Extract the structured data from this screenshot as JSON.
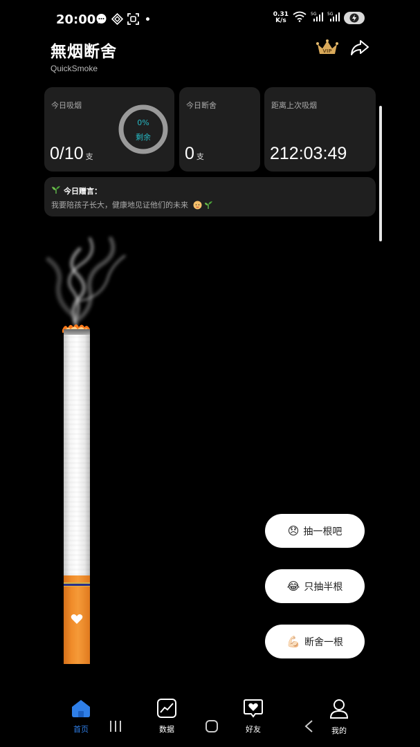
{
  "status_bar": {
    "time": "20:00",
    "net_speed_value": "0.31",
    "net_speed_unit": "K/s"
  },
  "header": {
    "title": "無烟断舍",
    "subtitle": "QuickSmoke",
    "vip_label": "VIP"
  },
  "stats": {
    "today_smoked": {
      "label": "今日吸烟",
      "value": "0/10",
      "unit": "支",
      "ring_percent_text": "0%",
      "ring_label": "剩余",
      "remaining_fraction": 0
    },
    "today_quit": {
      "label": "今日断舍",
      "value": "0",
      "unit": "支"
    },
    "since_last": {
      "label": "距离上次吸烟",
      "value": "212:03:49"
    }
  },
  "quote": {
    "title": "今日赠言：",
    "text": "我要陪孩子长大，健康地见证他们的未来"
  },
  "actions": [
    {
      "emoji": "😞",
      "label": "抽一根吧"
    },
    {
      "emoji": "😂",
      "label": "只抽半根"
    },
    {
      "emoji": "💪🏻",
      "label": "断舍一根"
    }
  ],
  "nav": [
    {
      "label": "首页",
      "icon": "home-icon",
      "active": true
    },
    {
      "label": "数据",
      "icon": "chart-icon",
      "active": false
    },
    {
      "label": "好友",
      "icon": "heart-chat-icon",
      "active": false
    },
    {
      "label": "我的",
      "icon": "profile-icon",
      "active": false
    }
  ],
  "colors": {
    "accent": "#2f7fe8",
    "ring": "#26b9c4",
    "card": "#1f1f1f",
    "filter": "#f08c2a"
  }
}
